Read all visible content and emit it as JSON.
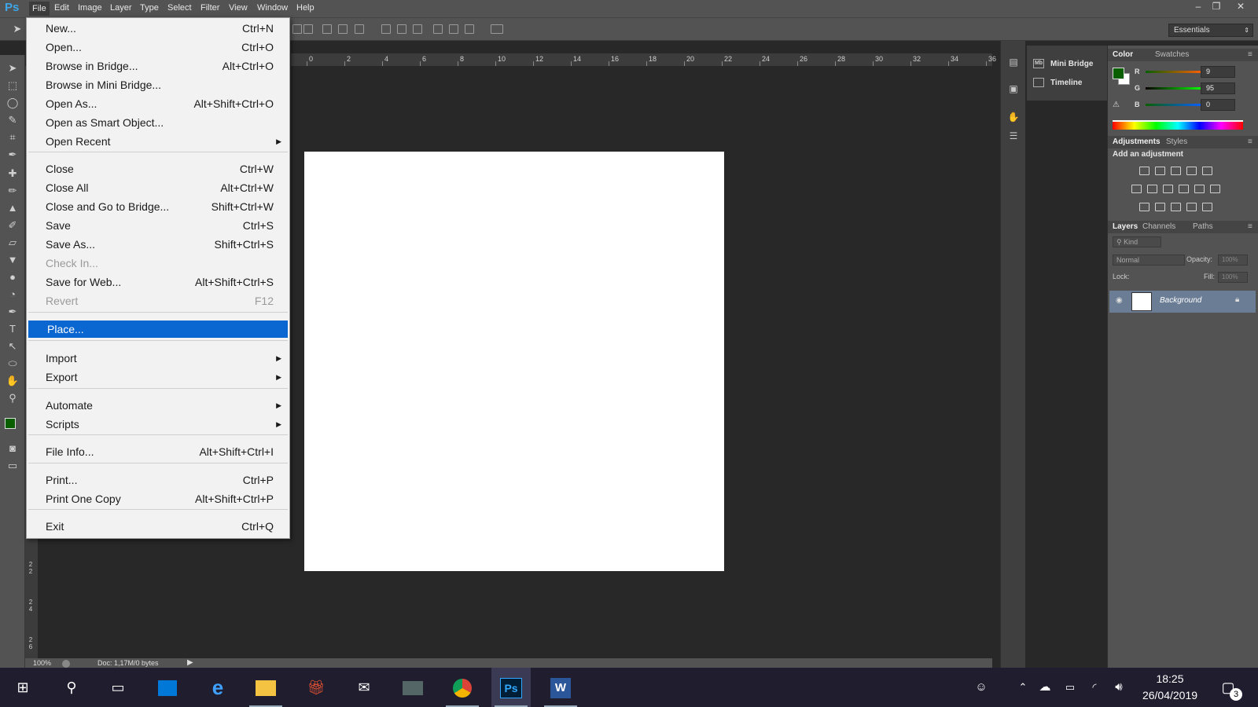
{
  "app": {
    "logo": "Ps",
    "title": ""
  },
  "menubar": {
    "items": [
      "File",
      "Edit",
      "Image",
      "Layer",
      "Type",
      "Select",
      "Filter",
      "View",
      "Window",
      "Help"
    ],
    "active": "File"
  },
  "window_controls": {
    "minimize": "–",
    "restore": "❐",
    "close": "✕"
  },
  "options_bar": {
    "workspace": "Essentials"
  },
  "file_menu": {
    "items": [
      {
        "label": "New...",
        "shortcut": "Ctrl+N"
      },
      {
        "label": "Open...",
        "shortcut": "Ctrl+O"
      },
      {
        "label": "Browse in Bridge...",
        "shortcut": "Alt+Ctrl+O"
      },
      {
        "label": "Browse in Mini Bridge...",
        "shortcut": ""
      },
      {
        "label": "Open As...",
        "shortcut": "Alt+Shift+Ctrl+O"
      },
      {
        "label": "Open as Smart Object...",
        "shortcut": ""
      },
      {
        "label": "Open Recent",
        "shortcut": "",
        "submenu": true
      },
      {
        "label": "Close",
        "shortcut": "Ctrl+W"
      },
      {
        "label": "Close All",
        "shortcut": "Alt+Ctrl+W"
      },
      {
        "label": "Close and Go to Bridge...",
        "shortcut": "Shift+Ctrl+W"
      },
      {
        "label": "Save",
        "shortcut": "Ctrl+S"
      },
      {
        "label": "Save As...",
        "shortcut": "Shift+Ctrl+S"
      },
      {
        "label": "Check In...",
        "shortcut": "",
        "disabled": true
      },
      {
        "label": "Save for Web...",
        "shortcut": "Alt+Shift+Ctrl+S"
      },
      {
        "label": "Revert",
        "shortcut": "F12",
        "disabled": true
      },
      {
        "label": "Place...",
        "shortcut": "",
        "highlighted": true
      },
      {
        "label": "Import",
        "shortcut": "",
        "submenu": true
      },
      {
        "label": "Export",
        "shortcut": "",
        "submenu": true
      },
      {
        "label": "Automate",
        "shortcut": "",
        "submenu": true
      },
      {
        "label": "Scripts",
        "shortcut": "",
        "submenu": true
      },
      {
        "label": "File Info...",
        "shortcut": "Alt+Shift+Ctrl+I"
      },
      {
        "label": "Print...",
        "shortcut": "Ctrl+P"
      },
      {
        "label": "Print One Copy",
        "shortcut": "Alt+Shift+Ctrl+P"
      },
      {
        "label": "Exit",
        "shortcut": "Ctrl+Q"
      }
    ]
  },
  "ruler": {
    "top_ticks": [
      "0",
      "2",
      "4",
      "6",
      "8",
      "10",
      "12",
      "14",
      "16",
      "18",
      "20",
      "22",
      "24",
      "26",
      "28",
      "30",
      "32",
      "34",
      "36"
    ],
    "left_ticks": [
      "2\n2",
      "2\n4",
      "2\n6"
    ]
  },
  "status": {
    "zoom": "100%",
    "doc": "Doc: 1,17M/0 bytes"
  },
  "collapsed_panels": {
    "mini_bridge": "Mini Bridge",
    "timeline": "Timeline",
    "mini_bridge_icon": "Mb"
  },
  "color_panel": {
    "tabs": [
      "Color",
      "Swatches"
    ],
    "r_label": "R",
    "g_label": "G",
    "b_label": "B",
    "r": "9",
    "g": "95",
    "b": "0",
    "foreground_color": "#095f00"
  },
  "adjustments_panel": {
    "tabs": [
      "Adjustments",
      "Styles"
    ],
    "heading": "Add an adjustment"
  },
  "layers_panel": {
    "tabs": [
      "Layers",
      "Channels",
      "Paths"
    ],
    "kind": "Kind",
    "blend_mode": "Normal",
    "opacity_label": "Opacity:",
    "opacity": "100%",
    "lock_label": "Lock:",
    "fill_label": "Fill:",
    "fill": "100%",
    "layer_name": "Background"
  },
  "taskbar": {
    "time": "18:25",
    "date": "26/04/2019",
    "notification_count": "3",
    "ps_label": "Ps",
    "word_label": "W"
  },
  "colors": {
    "accent": "#0a66d0",
    "ps_blue": "#3fa6e8"
  }
}
